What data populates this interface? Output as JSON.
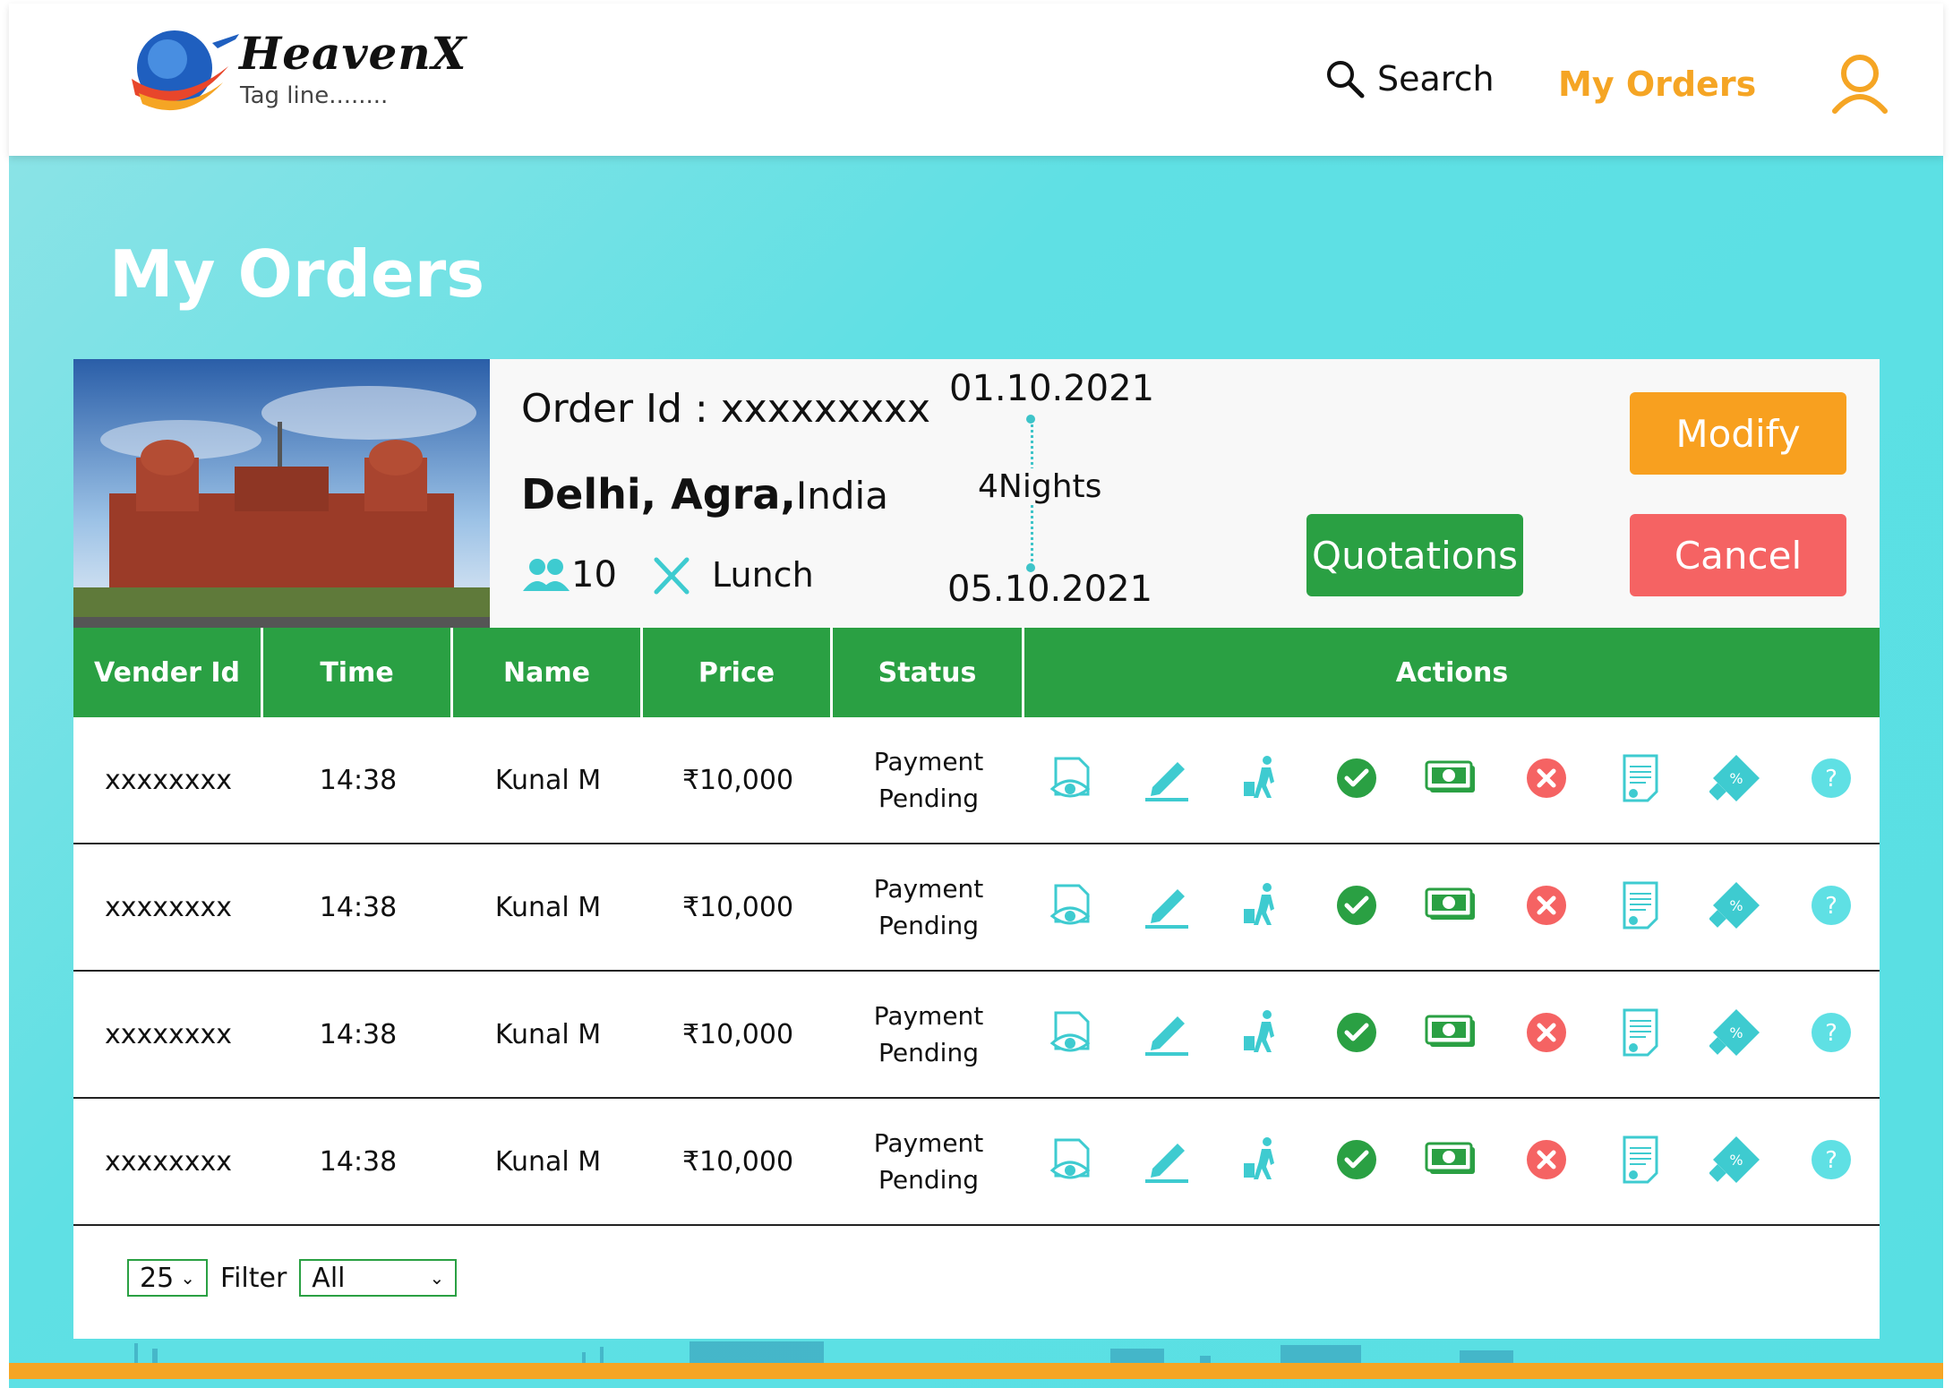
{
  "header": {
    "brand_name": "HeavenX",
    "brand_tagline": "Tag line........",
    "nav_search_label": "Search",
    "nav_orders_label": "My Orders",
    "accent_color": "#f5a524"
  },
  "page_title": "My Orders",
  "order": {
    "order_id_text": "Order Id : xxxxxxxxx",
    "destination_cities": "Delhi, Agra,",
    "destination_country": "India",
    "travellers": "10",
    "meal": "Lunch",
    "start_date": "01.10.2021",
    "duration": "4Nights",
    "end_date": "05.10.2021",
    "buttons": {
      "modify": "Modify",
      "quotations": "Quotations",
      "cancel": "Cancel"
    }
  },
  "table": {
    "columns": [
      "Vender Id",
      "Time",
      "Name",
      "Price",
      "Status",
      "Actions"
    ],
    "rows": [
      {
        "vendor_id": "xxxxxxxx",
        "time": "14:38",
        "name": "Kunal M",
        "price": "₹10,000",
        "status_line1": "Payment",
        "status_line2": "Pending"
      },
      {
        "vendor_id": "xxxxxxxx",
        "time": "14:38",
        "name": "Kunal M",
        "price": "₹10,000",
        "status_line1": "Payment",
        "status_line2": "Pending"
      },
      {
        "vendor_id": "xxxxxxxx",
        "time": "14:38",
        "name": "Kunal M",
        "price": "₹10,000",
        "status_line1": "Payment",
        "status_line2": "Pending"
      },
      {
        "vendor_id": "xxxxxxxx",
        "time": "14:38",
        "name": "Kunal M",
        "price": "₹10,000",
        "status_line1": "Payment",
        "status_line2": "Pending"
      }
    ],
    "action_icons": [
      "view-document-icon",
      "edit-pencil-icon",
      "traveller-luggage-icon",
      "approve-check-icon",
      "payment-cash-icon",
      "reject-x-icon",
      "invoice-icon",
      "discount-coupon-icon",
      "help-question-icon"
    ]
  },
  "footer": {
    "page_size": "25",
    "filter_label": "Filter",
    "filter_value": "All"
  },
  "colors": {
    "header_green": "#2aa043",
    "icon_teal": "#3ecbd0",
    "modify": "#f8a01f",
    "cancel": "#f56363"
  }
}
